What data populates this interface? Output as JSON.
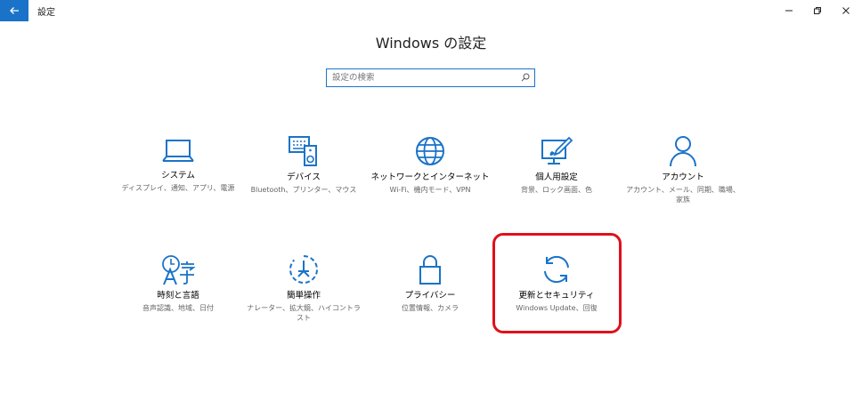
{
  "window": {
    "title": "設定",
    "back_icon": "back-arrow-icon",
    "controls": [
      "minimize-icon",
      "restore-icon",
      "close-icon"
    ]
  },
  "header": {
    "title": "Windows の設定",
    "search_placeholder": "設定の検索"
  },
  "tiles": [
    {
      "label": "システム",
      "desc": "ディスプレイ、通知、アプリ、電源",
      "icon": "laptop-icon"
    },
    {
      "label": "デバイス",
      "desc": "Bluetooth、プリンター、マウス",
      "icon": "devices-icon"
    },
    {
      "label": "ネットワークとインターネット",
      "desc": "Wi-Fi、機内モード、VPN",
      "icon": "globe-icon"
    },
    {
      "label": "個人用設定",
      "desc": "背景、ロック画面、色",
      "icon": "paint-icon"
    },
    {
      "label": "アカウント",
      "desc": "アカウント、メール、同期、職場、家族",
      "icon": "person-icon"
    },
    {
      "label": "時刻と言語",
      "desc": "音声認識、地域、日付",
      "icon": "language-icon"
    },
    {
      "label": "簡単操作",
      "desc": "ナレーター、拡大鏡、ハイコントラスト",
      "icon": "ease-of-access-icon"
    },
    {
      "label": "プライバシー",
      "desc": "位置情報、カメラ",
      "icon": "lock-icon"
    },
    {
      "label": "更新とセキュリティ",
      "desc": "Windows Update、回復",
      "icon": "sync-icon"
    }
  ],
  "colors": {
    "accent": "#1a73c8",
    "highlight": "#e0101a"
  }
}
